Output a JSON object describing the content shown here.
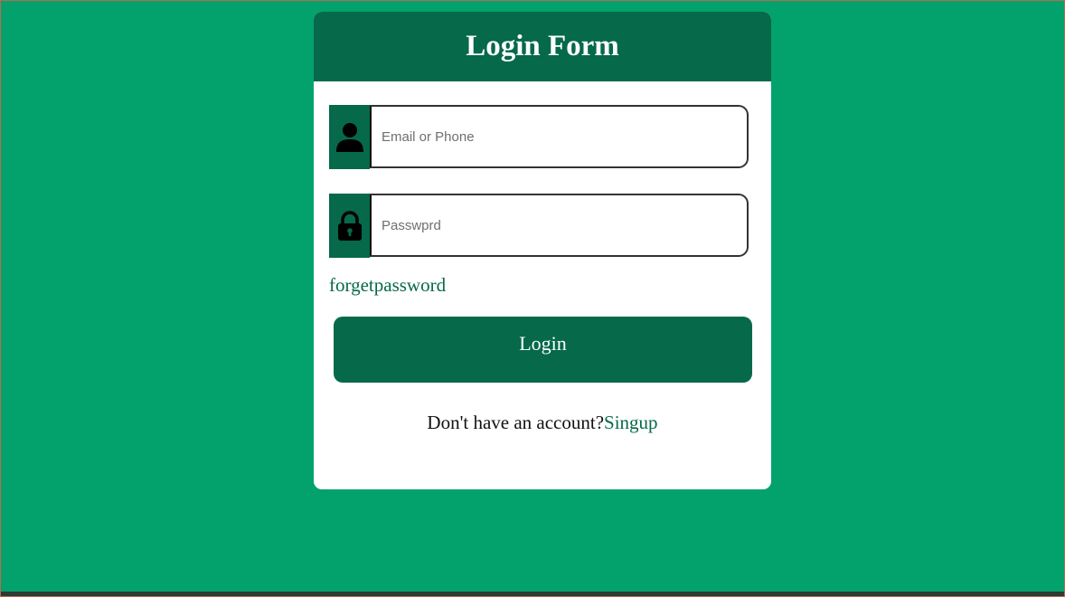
{
  "form": {
    "title": "Login Form",
    "email": {
      "placeholder": "Email or Phone",
      "value": "",
      "icon": "user-icon"
    },
    "password": {
      "placeholder": "Passwprd",
      "value": "",
      "icon": "lock-icon"
    },
    "forget_label": "forgetpassword",
    "login_label": "Login",
    "signup_prompt": "Don't have an account?",
    "signup_label": "Singup"
  },
  "colors": {
    "background": "#03a26c",
    "accent": "#05694a",
    "card": "#ffffff"
  }
}
